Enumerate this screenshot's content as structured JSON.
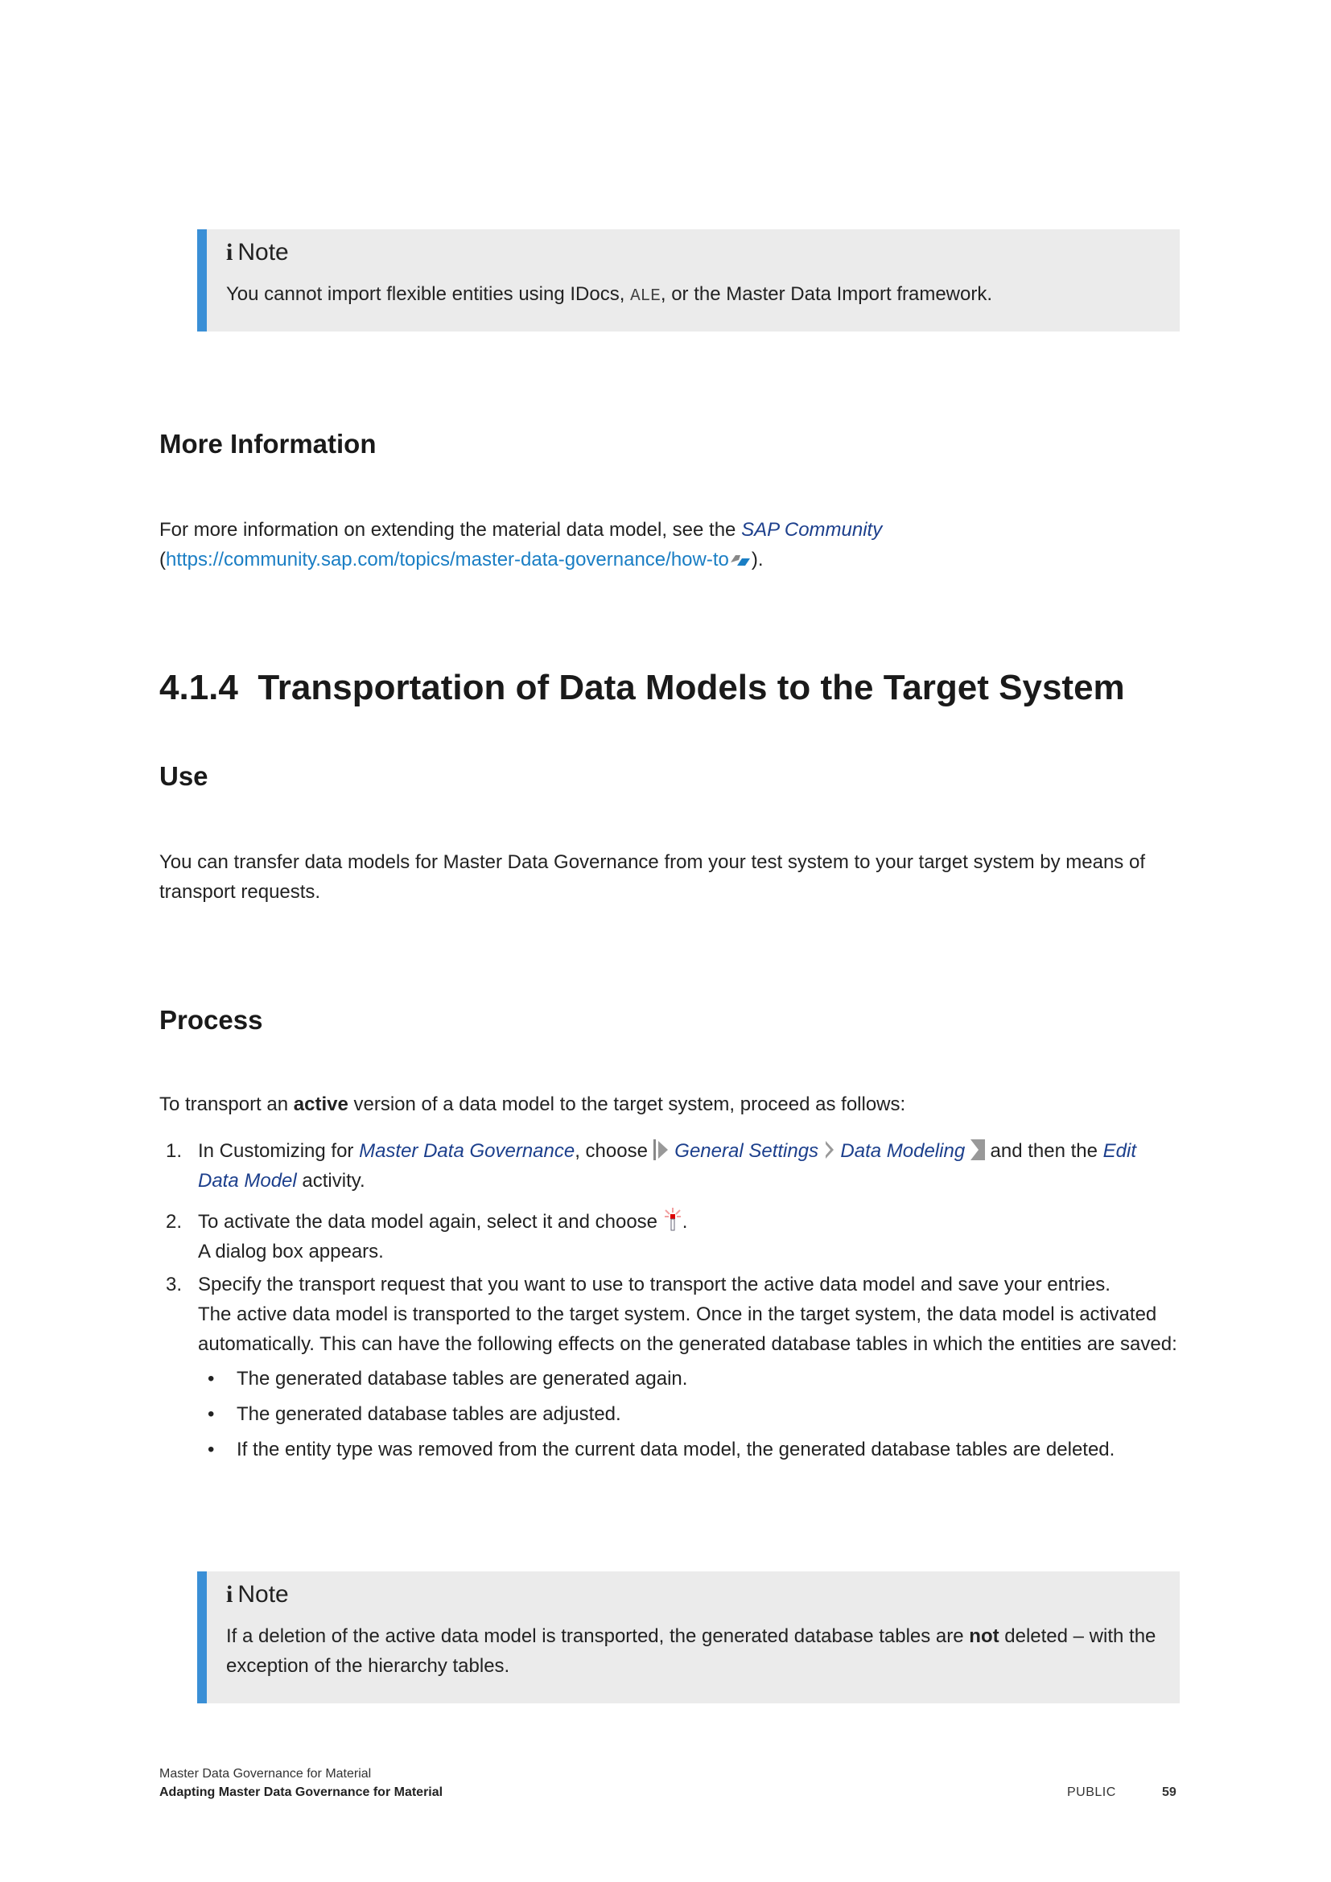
{
  "note1": {
    "title": "Note",
    "text_before": "You cannot import flexible entities using IDocs, ",
    "code": "ALE",
    "text_after": ", or the Master Data Import framework."
  },
  "more_info": {
    "heading": "More Information",
    "text_before": "For more information on extending the material data model, see the ",
    "link_title": "SAP Community",
    "paren_open": " (",
    "url": "https://community.sap.com/topics/master-data-governance/how-to",
    "paren_close": ")."
  },
  "section": {
    "number": "4.1.4",
    "title": "Transportation of Data Models to the Target System"
  },
  "use": {
    "heading": "Use",
    "text": "You can transfer data models for Master Data Governance from your test system to your target system by means of transport requests."
  },
  "process": {
    "heading": "Process",
    "intro_before": "To transport an ",
    "intro_bold": "active",
    "intro_after": " version of a data model to the target system, proceed as follows:",
    "steps": [
      {
        "num": "1.",
        "t1": "In Customizing for ",
        "l1": "Master Data Governance",
        "t2": ", choose ",
        "p1": "General Settings",
        "p2": "Data Modeling",
        "t3": " and then the ",
        "l2": "Edit Data Model",
        "t4": " activity."
      },
      {
        "num": "2.",
        "t1": "To activate the data model again, select it and choose ",
        "t2": ".",
        "t3": "A dialog box appears."
      },
      {
        "num": "3.",
        "t1": "Specify the transport request that you want to use to transport the active data model and save your entries.",
        "t2": "The active data model is transported to the target system. Once in the target system, the data model is activated automatically. This can have the following effects on the generated database tables in which the entities are saved:"
      }
    ],
    "bullets": [
      "The generated database tables are generated again.",
      "The generated database tables are adjusted.",
      "If the entity type was removed from the current data model, the generated database tables are deleted."
    ],
    "bullet_char": "•"
  },
  "note2": {
    "title": "Note",
    "text_before": "If a deletion of the active data model is transported, the generated database tables are ",
    "bold": "not",
    "text_after": " deleted – with the exception of the hierarchy tables."
  },
  "footer": {
    "line1": "Master Data Governance for Material",
    "line2": "Adapting Master Data Governance for Material",
    "classification": "PUBLIC",
    "page": "59"
  },
  "colors": {
    "note_bar": "#3a8fd6",
    "note_bg": "#ebebeb",
    "link": "#1a7ec4",
    "emphasis": "#1c3f8c"
  }
}
